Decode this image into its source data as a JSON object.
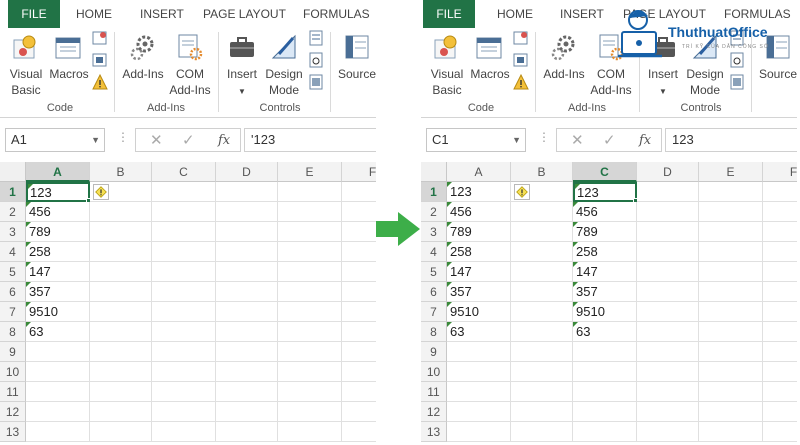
{
  "tabs": [
    "FILE",
    "HOME",
    "INSERT",
    "PAGE LAYOUT",
    "FORMULAS"
  ],
  "ribbon": {
    "visual_basic": [
      "Visual",
      "Basic"
    ],
    "macros": "Macros",
    "add_ins": "Add-Ins",
    "com_add_ins": [
      "COM",
      "Add-Ins"
    ],
    "insert": "Insert",
    "design_mode": [
      "Design",
      "Mode"
    ],
    "source": "Source",
    "groups": {
      "code": "Code",
      "add_ins": "Add-Ins",
      "controls": "Controls"
    }
  },
  "formula_bar": {
    "fx": "fx",
    "cancel": "✕",
    "confirm": "✓"
  },
  "columns": [
    "A",
    "B",
    "C",
    "D",
    "E",
    "F"
  ],
  "rows": [
    "1",
    "2",
    "3",
    "4",
    "5",
    "6",
    "7",
    "8",
    "9",
    "10",
    "11",
    "12",
    "13"
  ],
  "values": [
    "123",
    "456",
    "789",
    "258",
    "147",
    "357",
    "9510",
    "63"
  ],
  "left_sheet": {
    "name_box": "A1",
    "formula": "'123",
    "selected_column": "A",
    "active_cell": "A1"
  },
  "right_sheet": {
    "name_box": "C1",
    "formula": "123",
    "selected_column": "C",
    "active_cell": "C1"
  },
  "watermark": {
    "brand": "ThuthuatOffice",
    "tagline": "TRÍ KỸ CỦA DÂN CÔNG SỞ"
  },
  "colors": {
    "excel_green": "#217346",
    "arrow_green": "#3dae49",
    "brand_blue": "#1660a8"
  }
}
